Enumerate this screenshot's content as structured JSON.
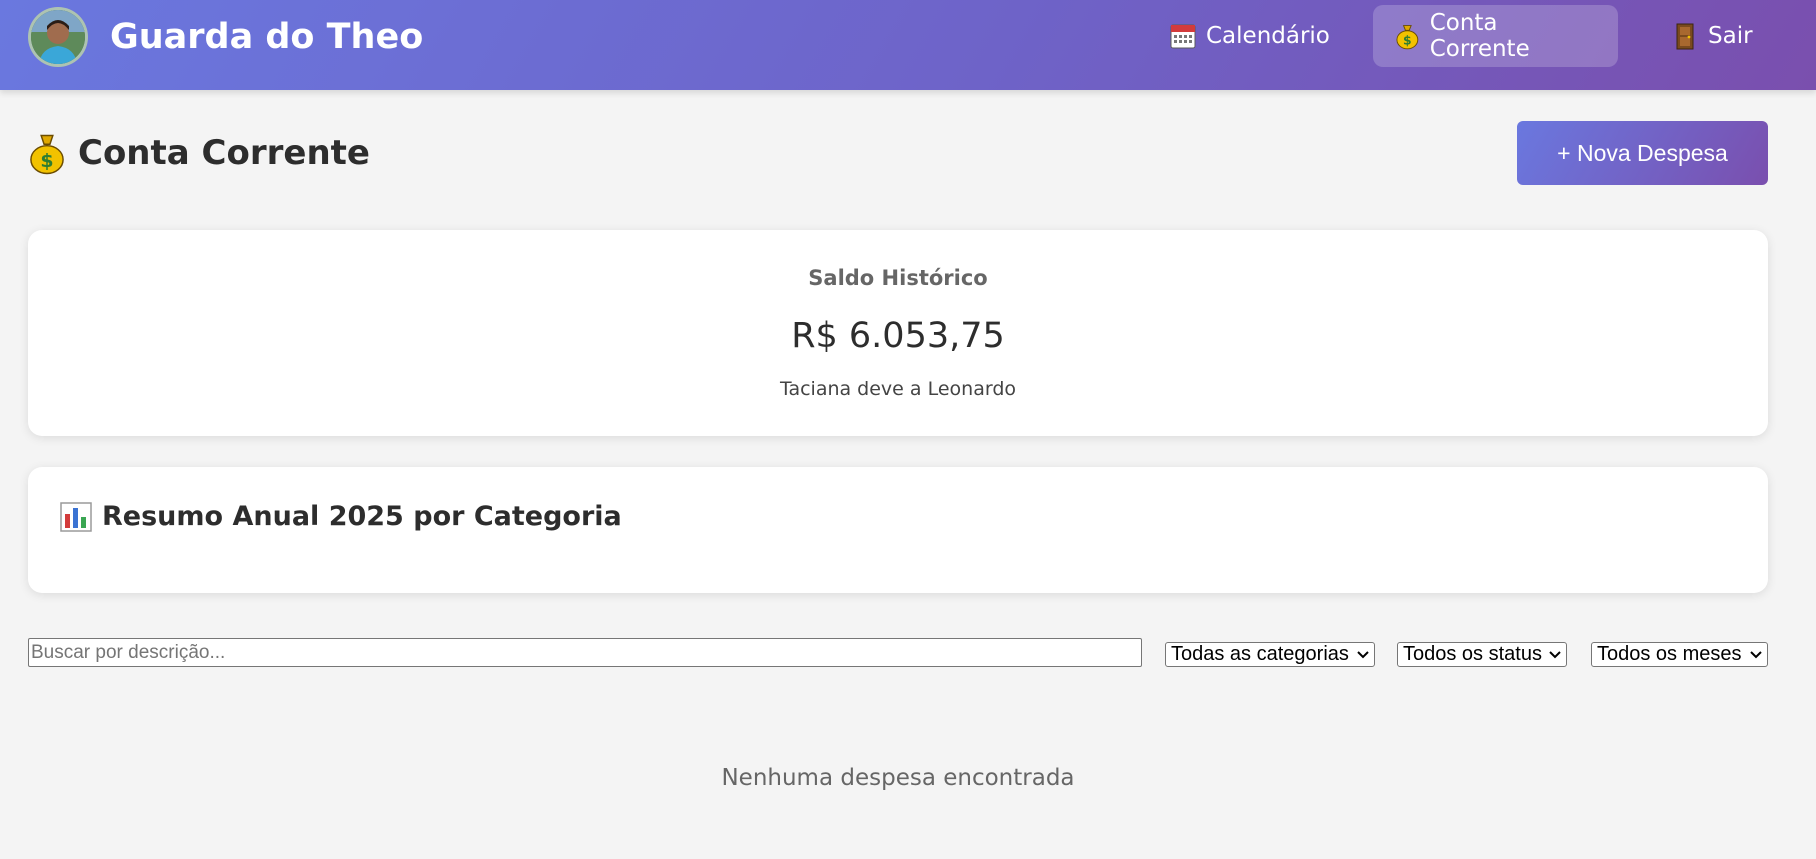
{
  "app": {
    "brand": "Guarda do Theo"
  },
  "nav": {
    "calendar_label": "Calendário",
    "account_label": "Conta Corrente",
    "logout_label": "Sair"
  },
  "page": {
    "title": "Conta Corrente",
    "new_expense_label": "+ Nova Despesa"
  },
  "balance": {
    "label": "Saldo Histórico",
    "value": "R$ 6.053,75",
    "note": "Taciana deve a Leonardo"
  },
  "summary": {
    "title": "Resumo Anual 2025 por Categoria"
  },
  "filters": {
    "search_placeholder": "Buscar por descrição...",
    "category_selected": "Todas as categorias",
    "status_selected": "Todos os status",
    "month_selected": "Todos os meses"
  },
  "empty_state": "Nenhuma despesa encontrada",
  "colors": {
    "accent_start": "#6a78df",
    "accent_end": "#7a4fae",
    "background": "#f4f4f4"
  }
}
